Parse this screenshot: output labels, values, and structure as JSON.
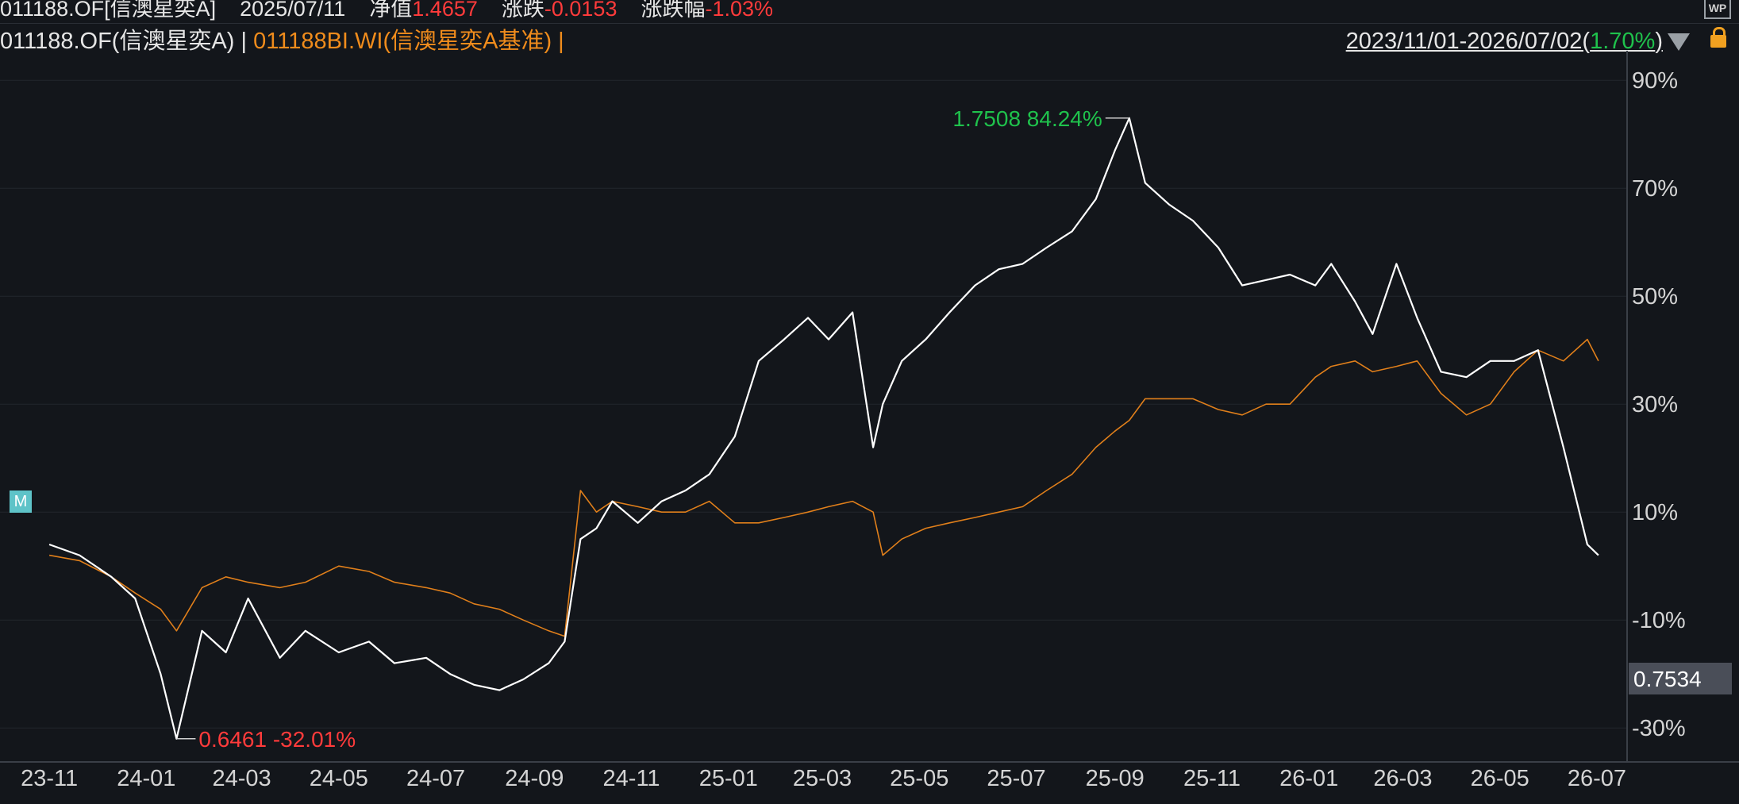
{
  "header": {
    "code": "011188.OF[信澳星奕A]",
    "date": "2025/07/11",
    "nav_label": "净值",
    "nav_value": "1.4657",
    "change_label": "涨跌",
    "change_value": "-0.0153",
    "change_pct_label": "涨跌幅",
    "change_pct_value": "-1.03%"
  },
  "legend": {
    "series1": "011188.OF(信澳星奕A)",
    "sep1": " | ",
    "series2": "011188BI.WI(信澳星奕A基准)",
    "sep2": " |",
    "range": "2023/11/01-2026/07/02(",
    "range_pct": "1.70%",
    "range_close": ")"
  },
  "badge": "M",
  "price_tag": "0.7534",
  "colors": {
    "fund": "#ffffff",
    "benchmark": "#e07f1b",
    "max": "#1fc24c",
    "min": "#ff3b3b",
    "bg": "#13161b"
  },
  "icons": [
    "dropdown-triangle-icon",
    "lock-icon",
    "wp-icon"
  ],
  "chart_data": {
    "type": "line",
    "x_ticks": [
      "23-11",
      "24-01",
      "24-03",
      "24-05",
      "24-07",
      "24-09",
      "24-11",
      "25-01",
      "25-03",
      "25-05",
      "25-07",
      "25-09",
      "25-11",
      "26-01",
      "26-03",
      "26-05",
      "26-07"
    ],
    "y_ticks": [
      "90%",
      "70%",
      "50%",
      "30%",
      "10%",
      "-10%",
      "-30%"
    ],
    "y_tick_values": [
      90,
      70,
      50,
      30,
      10,
      -10,
      -30
    ],
    "ylim": [
      -36,
      94
    ],
    "max_annotation": "1.7508 84.24%",
    "min_annotation": "0.6461 -32.01%",
    "series": [
      {
        "name": "011188.OF(信澳星奕A)",
        "x": [
          "2023-11-01",
          "2023-11-20",
          "2023-12-10",
          "2023-12-25",
          "2024-01-10",
          "2024-01-20",
          "2024-02-05",
          "2024-02-20",
          "2024-03-05",
          "2024-03-25",
          "2024-04-10",
          "2024-05-01",
          "2024-05-20",
          "2024-06-05",
          "2024-06-25",
          "2024-07-10",
          "2024-07-25",
          "2024-08-10",
          "2024-08-25",
          "2024-09-10",
          "2024-09-20",
          "2024-09-30",
          "2024-10-10",
          "2024-10-20",
          "2024-11-05",
          "2024-11-20",
          "2024-12-05",
          "2024-12-20",
          "2025-01-05",
          "2025-01-20",
          "2025-02-05",
          "2025-02-20",
          "2025-03-05",
          "2025-03-20",
          "2025-04-02",
          "2025-04-08",
          "2025-04-20",
          "2025-05-05",
          "2025-05-20",
          "2025-06-05",
          "2025-06-20",
          "2025-07-05",
          "2025-07-20",
          "2025-08-05",
          "2025-08-20",
          "2025-09-01",
          "2025-09-10",
          "2025-09-20",
          "2025-10-05",
          "2025-10-20",
          "2025-11-05",
          "2025-11-20",
          "2025-12-05",
          "2025-12-20",
          "2026-01-05",
          "2026-01-15",
          "2026-01-30",
          "2026-02-10",
          "2026-02-25",
          "2026-03-10",
          "2026-03-25",
          "2026-04-10",
          "2026-04-25",
          "2026-05-10",
          "2026-05-25",
          "2026-06-10",
          "2026-06-25",
          "2026-07-02"
        ],
        "values": [
          4,
          2,
          -2,
          -6,
          -20,
          -32,
          -12,
          -16,
          -6,
          -17,
          -12,
          -16,
          -14,
          -18,
          -17,
          -20,
          -22,
          -23,
          -21,
          -18,
          -14,
          5,
          7,
          12,
          8,
          12,
          14,
          17,
          24,
          38,
          42,
          46,
          42,
          47,
          22,
          30,
          38,
          42,
          47,
          52,
          55,
          56,
          59,
          62,
          68,
          77,
          83,
          71,
          67,
          64,
          59,
          52,
          53,
          54,
          52,
          56,
          49,
          43,
          56,
          46,
          36,
          35,
          38,
          38,
          40,
          22,
          4,
          2
        ]
      },
      {
        "name": "011188BI.WI(信澳星奕A基准)",
        "x": [
          "2023-11-01",
          "2023-11-20",
          "2023-12-10",
          "2023-12-25",
          "2024-01-10",
          "2024-01-20",
          "2024-02-05",
          "2024-02-20",
          "2024-03-05",
          "2024-03-25",
          "2024-04-10",
          "2024-05-01",
          "2024-05-20",
          "2024-06-05",
          "2024-06-25",
          "2024-07-10",
          "2024-07-25",
          "2024-08-10",
          "2024-08-25",
          "2024-09-10",
          "2024-09-20",
          "2024-09-30",
          "2024-10-10",
          "2024-10-20",
          "2024-11-05",
          "2024-11-20",
          "2024-12-05",
          "2024-12-20",
          "2025-01-05",
          "2025-01-20",
          "2025-02-05",
          "2025-02-20",
          "2025-03-05",
          "2025-03-20",
          "2025-04-02",
          "2025-04-08",
          "2025-04-20",
          "2025-05-05",
          "2025-05-20",
          "2025-06-05",
          "2025-06-20",
          "2025-07-05",
          "2025-07-20",
          "2025-08-05",
          "2025-08-20",
          "2025-09-01",
          "2025-09-10",
          "2025-09-20",
          "2025-10-05",
          "2025-10-20",
          "2025-11-05",
          "2025-11-20",
          "2025-12-05",
          "2025-12-20",
          "2026-01-05",
          "2026-01-15",
          "2026-01-30",
          "2026-02-10",
          "2026-02-25",
          "2026-03-10",
          "2026-03-25",
          "2026-04-10",
          "2026-04-25",
          "2026-05-10",
          "2026-05-25",
          "2026-06-10",
          "2026-06-25",
          "2026-07-02"
        ],
        "values": [
          2,
          1,
          -2,
          -5,
          -8,
          -12,
          -4,
          -2,
          -3,
          -4,
          -3,
          0,
          -1,
          -3,
          -4,
          -5,
          -7,
          -8,
          -10,
          -12,
          -13,
          14,
          10,
          12,
          11,
          10,
          10,
          12,
          8,
          8,
          9,
          10,
          11,
          12,
          10,
          2,
          5,
          7,
          8,
          9,
          10,
          11,
          14,
          17,
          22,
          25,
          27,
          31,
          31,
          31,
          29,
          28,
          30,
          30,
          35,
          37,
          38,
          36,
          37,
          38,
          32,
          28,
          30,
          36,
          40,
          38,
          42,
          38
        ]
      }
    ]
  }
}
